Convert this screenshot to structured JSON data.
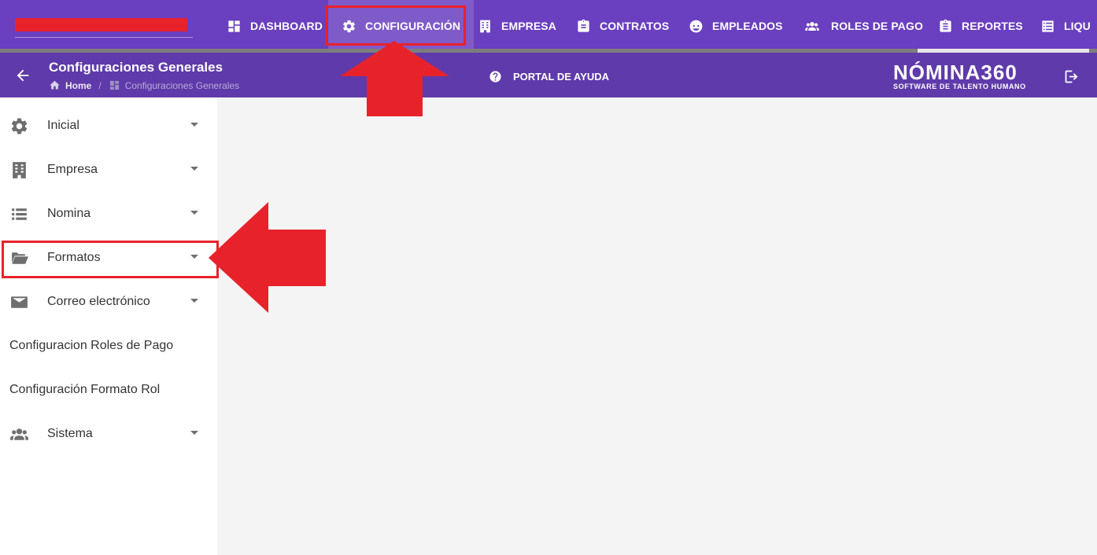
{
  "nav": {
    "items": [
      {
        "label": "DASHBOARD",
        "icon": "dashboard-icon"
      },
      {
        "label": "CONFIGURACIÓN",
        "icon": "gear-icon"
      },
      {
        "label": "EMPRESA",
        "icon": "building-icon"
      },
      {
        "label": "CONTRATOS",
        "icon": "clipboard-icon"
      },
      {
        "label": "EMPLEADOS",
        "icon": "face-icon"
      },
      {
        "label": "ROLES DE PAGO",
        "icon": "people-icon"
      },
      {
        "label": "REPORTES",
        "icon": "clipboard-list-icon"
      },
      {
        "label": "LIQU",
        "icon": "list-icon"
      }
    ],
    "active": "CONFIGURACIÓN"
  },
  "subheader": {
    "title": "Configuraciones Generales",
    "breadcrumb_home": "Home",
    "breadcrumb_separator": "/",
    "breadcrumb_current": "Configuraciones Generales",
    "help_label": "PORTAL DE AYUDA",
    "logo_main": "NÓMINA360",
    "logo_sub": "SOFTWARE DE TALENTO HUMANO"
  },
  "sidebar": {
    "items": [
      {
        "label": "Inicial",
        "icon": "gear-icon",
        "expandable": true
      },
      {
        "label": "Empresa",
        "icon": "building-icon",
        "expandable": true
      },
      {
        "label": "Nomina",
        "icon": "list-icon",
        "expandable": true
      },
      {
        "label": "Formatos",
        "icon": "folder-open-icon",
        "expandable": true
      },
      {
        "label": "Correo electrónico",
        "icon": "mail-icon",
        "expandable": true
      },
      {
        "label": "Configuracion Roles de Pago",
        "icon": "",
        "expandable": false
      },
      {
        "label": "Configuración Formato Rol",
        "icon": "",
        "expandable": false
      },
      {
        "label": "Sistema",
        "icon": "people-icon",
        "expandable": true
      }
    ]
  },
  "colors": {
    "topbar": "#6a3fc0",
    "subbar": "#5f3aaa",
    "annotation": "#e8222b",
    "sidebar_bg": "#ffffff",
    "content_bg": "#f4f4f4"
  }
}
